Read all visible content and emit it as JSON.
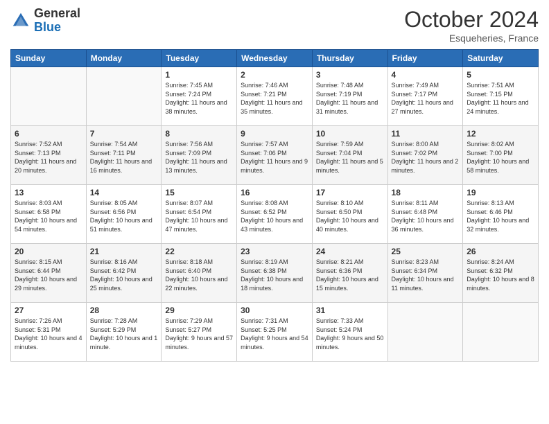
{
  "header": {
    "logo_general": "General",
    "logo_blue": "Blue",
    "month_title": "October 2024",
    "location": "Esqueheries, France"
  },
  "days_of_week": [
    "Sunday",
    "Monday",
    "Tuesday",
    "Wednesday",
    "Thursday",
    "Friday",
    "Saturday"
  ],
  "weeks": [
    [
      {
        "day": "",
        "sunrise": "",
        "sunset": "",
        "daylight": ""
      },
      {
        "day": "",
        "sunrise": "",
        "sunset": "",
        "daylight": ""
      },
      {
        "day": "1",
        "sunrise": "Sunrise: 7:45 AM",
        "sunset": "Sunset: 7:24 PM",
        "daylight": "Daylight: 11 hours and 38 minutes."
      },
      {
        "day": "2",
        "sunrise": "Sunrise: 7:46 AM",
        "sunset": "Sunset: 7:21 PM",
        "daylight": "Daylight: 11 hours and 35 minutes."
      },
      {
        "day": "3",
        "sunrise": "Sunrise: 7:48 AM",
        "sunset": "Sunset: 7:19 PM",
        "daylight": "Daylight: 11 hours and 31 minutes."
      },
      {
        "day": "4",
        "sunrise": "Sunrise: 7:49 AM",
        "sunset": "Sunset: 7:17 PM",
        "daylight": "Daylight: 11 hours and 27 minutes."
      },
      {
        "day": "5",
        "sunrise": "Sunrise: 7:51 AM",
        "sunset": "Sunset: 7:15 PM",
        "daylight": "Daylight: 11 hours and 24 minutes."
      }
    ],
    [
      {
        "day": "6",
        "sunrise": "Sunrise: 7:52 AM",
        "sunset": "Sunset: 7:13 PM",
        "daylight": "Daylight: 11 hours and 20 minutes."
      },
      {
        "day": "7",
        "sunrise": "Sunrise: 7:54 AM",
        "sunset": "Sunset: 7:11 PM",
        "daylight": "Daylight: 11 hours and 16 minutes."
      },
      {
        "day": "8",
        "sunrise": "Sunrise: 7:56 AM",
        "sunset": "Sunset: 7:09 PM",
        "daylight": "Daylight: 11 hours and 13 minutes."
      },
      {
        "day": "9",
        "sunrise": "Sunrise: 7:57 AM",
        "sunset": "Sunset: 7:06 PM",
        "daylight": "Daylight: 11 hours and 9 minutes."
      },
      {
        "day": "10",
        "sunrise": "Sunrise: 7:59 AM",
        "sunset": "Sunset: 7:04 PM",
        "daylight": "Daylight: 11 hours and 5 minutes."
      },
      {
        "day": "11",
        "sunrise": "Sunrise: 8:00 AM",
        "sunset": "Sunset: 7:02 PM",
        "daylight": "Daylight: 11 hours and 2 minutes."
      },
      {
        "day": "12",
        "sunrise": "Sunrise: 8:02 AM",
        "sunset": "Sunset: 7:00 PM",
        "daylight": "Daylight: 10 hours and 58 minutes."
      }
    ],
    [
      {
        "day": "13",
        "sunrise": "Sunrise: 8:03 AM",
        "sunset": "Sunset: 6:58 PM",
        "daylight": "Daylight: 10 hours and 54 minutes."
      },
      {
        "day": "14",
        "sunrise": "Sunrise: 8:05 AM",
        "sunset": "Sunset: 6:56 PM",
        "daylight": "Daylight: 10 hours and 51 minutes."
      },
      {
        "day": "15",
        "sunrise": "Sunrise: 8:07 AM",
        "sunset": "Sunset: 6:54 PM",
        "daylight": "Daylight: 10 hours and 47 minutes."
      },
      {
        "day": "16",
        "sunrise": "Sunrise: 8:08 AM",
        "sunset": "Sunset: 6:52 PM",
        "daylight": "Daylight: 10 hours and 43 minutes."
      },
      {
        "day": "17",
        "sunrise": "Sunrise: 8:10 AM",
        "sunset": "Sunset: 6:50 PM",
        "daylight": "Daylight: 10 hours and 40 minutes."
      },
      {
        "day": "18",
        "sunrise": "Sunrise: 8:11 AM",
        "sunset": "Sunset: 6:48 PM",
        "daylight": "Daylight: 10 hours and 36 minutes."
      },
      {
        "day": "19",
        "sunrise": "Sunrise: 8:13 AM",
        "sunset": "Sunset: 6:46 PM",
        "daylight": "Daylight: 10 hours and 32 minutes."
      }
    ],
    [
      {
        "day": "20",
        "sunrise": "Sunrise: 8:15 AM",
        "sunset": "Sunset: 6:44 PM",
        "daylight": "Daylight: 10 hours and 29 minutes."
      },
      {
        "day": "21",
        "sunrise": "Sunrise: 8:16 AM",
        "sunset": "Sunset: 6:42 PM",
        "daylight": "Daylight: 10 hours and 25 minutes."
      },
      {
        "day": "22",
        "sunrise": "Sunrise: 8:18 AM",
        "sunset": "Sunset: 6:40 PM",
        "daylight": "Daylight: 10 hours and 22 minutes."
      },
      {
        "day": "23",
        "sunrise": "Sunrise: 8:19 AM",
        "sunset": "Sunset: 6:38 PM",
        "daylight": "Daylight: 10 hours and 18 minutes."
      },
      {
        "day": "24",
        "sunrise": "Sunrise: 8:21 AM",
        "sunset": "Sunset: 6:36 PM",
        "daylight": "Daylight: 10 hours and 15 minutes."
      },
      {
        "day": "25",
        "sunrise": "Sunrise: 8:23 AM",
        "sunset": "Sunset: 6:34 PM",
        "daylight": "Daylight: 10 hours and 11 minutes."
      },
      {
        "day": "26",
        "sunrise": "Sunrise: 8:24 AM",
        "sunset": "Sunset: 6:32 PM",
        "daylight": "Daylight: 10 hours and 8 minutes."
      }
    ],
    [
      {
        "day": "27",
        "sunrise": "Sunrise: 7:26 AM",
        "sunset": "Sunset: 5:31 PM",
        "daylight": "Daylight: 10 hours and 4 minutes."
      },
      {
        "day": "28",
        "sunrise": "Sunrise: 7:28 AM",
        "sunset": "Sunset: 5:29 PM",
        "daylight": "Daylight: 10 hours and 1 minute."
      },
      {
        "day": "29",
        "sunrise": "Sunrise: 7:29 AM",
        "sunset": "Sunset: 5:27 PM",
        "daylight": "Daylight: 9 hours and 57 minutes."
      },
      {
        "day": "30",
        "sunrise": "Sunrise: 7:31 AM",
        "sunset": "Sunset: 5:25 PM",
        "daylight": "Daylight: 9 hours and 54 minutes."
      },
      {
        "day": "31",
        "sunrise": "Sunrise: 7:33 AM",
        "sunset": "Sunset: 5:24 PM",
        "daylight": "Daylight: 9 hours and 50 minutes."
      },
      {
        "day": "",
        "sunrise": "",
        "sunset": "",
        "daylight": ""
      },
      {
        "day": "",
        "sunrise": "",
        "sunset": "",
        "daylight": ""
      }
    ]
  ]
}
